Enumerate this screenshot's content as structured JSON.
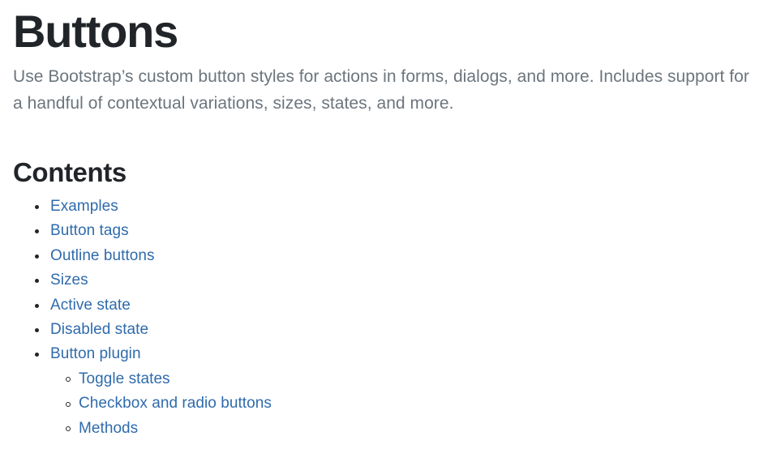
{
  "page": {
    "title": "Buttons",
    "lead": "Use Bootstrap’s custom button styles for actions in forms, dialogs, and more. Includes support for a handful of contextual variations, sizes, states, and more.",
    "background_color": "#ffffff",
    "heading_color": "#212529",
    "lead_color": "#6c757d",
    "link_color": "#2f6bac"
  },
  "contents": {
    "heading": "Contents",
    "items": [
      {
        "label": "Examples"
      },
      {
        "label": "Button tags"
      },
      {
        "label": "Outline buttons"
      },
      {
        "label": "Sizes"
      },
      {
        "label": "Active state"
      },
      {
        "label": "Disabled state"
      },
      {
        "label": "Button plugin"
      }
    ],
    "subitems": [
      {
        "label": "Toggle states"
      },
      {
        "label": "Checkbox and radio buttons"
      },
      {
        "label": "Methods"
      }
    ]
  }
}
